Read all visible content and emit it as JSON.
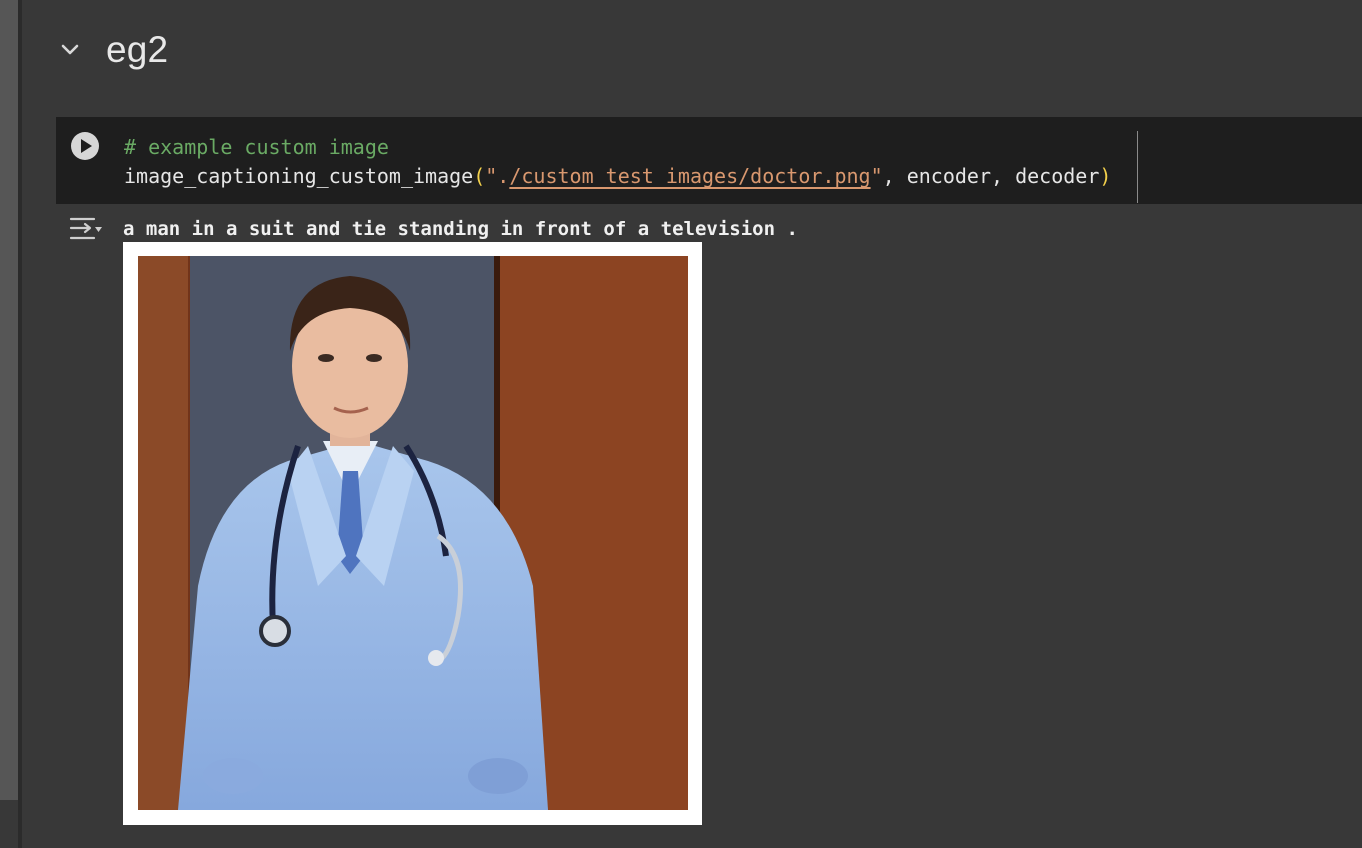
{
  "section": {
    "title": "eg2"
  },
  "cell": {
    "comment": "# example custom image",
    "function_name": "image_captioning_custom_image",
    "open_paren": "(",
    "quote_open": "\".",
    "path": "/custom_test_images/doctor.png",
    "quote_close": "\"",
    "args_rest": ", encoder, decoder",
    "close_paren": ")"
  },
  "output": {
    "caption": "a man in a suit and tie standing in front of a television ."
  },
  "icons": {
    "collapse": "chevron-down-icon",
    "run": "play-icon",
    "output": "output-toggle-icon"
  },
  "colors": {
    "background": "#383838",
    "cell_background": "#1e1e1e",
    "comment": "#6aaa64",
    "string": "#d9986f",
    "paren": "#f2d04b"
  }
}
